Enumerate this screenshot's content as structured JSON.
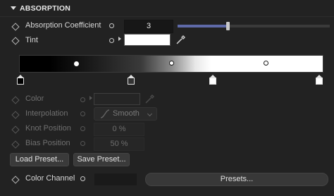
{
  "section": {
    "title": "ABSORPTION"
  },
  "absorption_coefficient": {
    "label": "Absorption Coefficient",
    "value": "3",
    "slider_fraction": 0.33
  },
  "tint": {
    "label": "Tint",
    "color": "#ffffff"
  },
  "gradient": {
    "stops": [
      "#000000",
      "#333333",
      "#ffffff",
      "#ffffff"
    ],
    "knots": [
      "filled",
      "hollow",
      "hollow"
    ]
  },
  "knot": {
    "color_label": "Color",
    "interpolation_label": "Interpolation",
    "interpolation_value": "Smooth",
    "knot_position_label": "Knot Position",
    "knot_position_value": "0 %",
    "bias_position_label": "Bias Position",
    "bias_position_value": "50 %"
  },
  "buttons": {
    "load_preset": "Load Preset...",
    "save_preset": "Save Preset...",
    "presets": "Presets..."
  },
  "color_channel": {
    "label": "Color Channel"
  },
  "colors": {
    "accent": "#5f6aa8",
    "background": "#222222"
  }
}
